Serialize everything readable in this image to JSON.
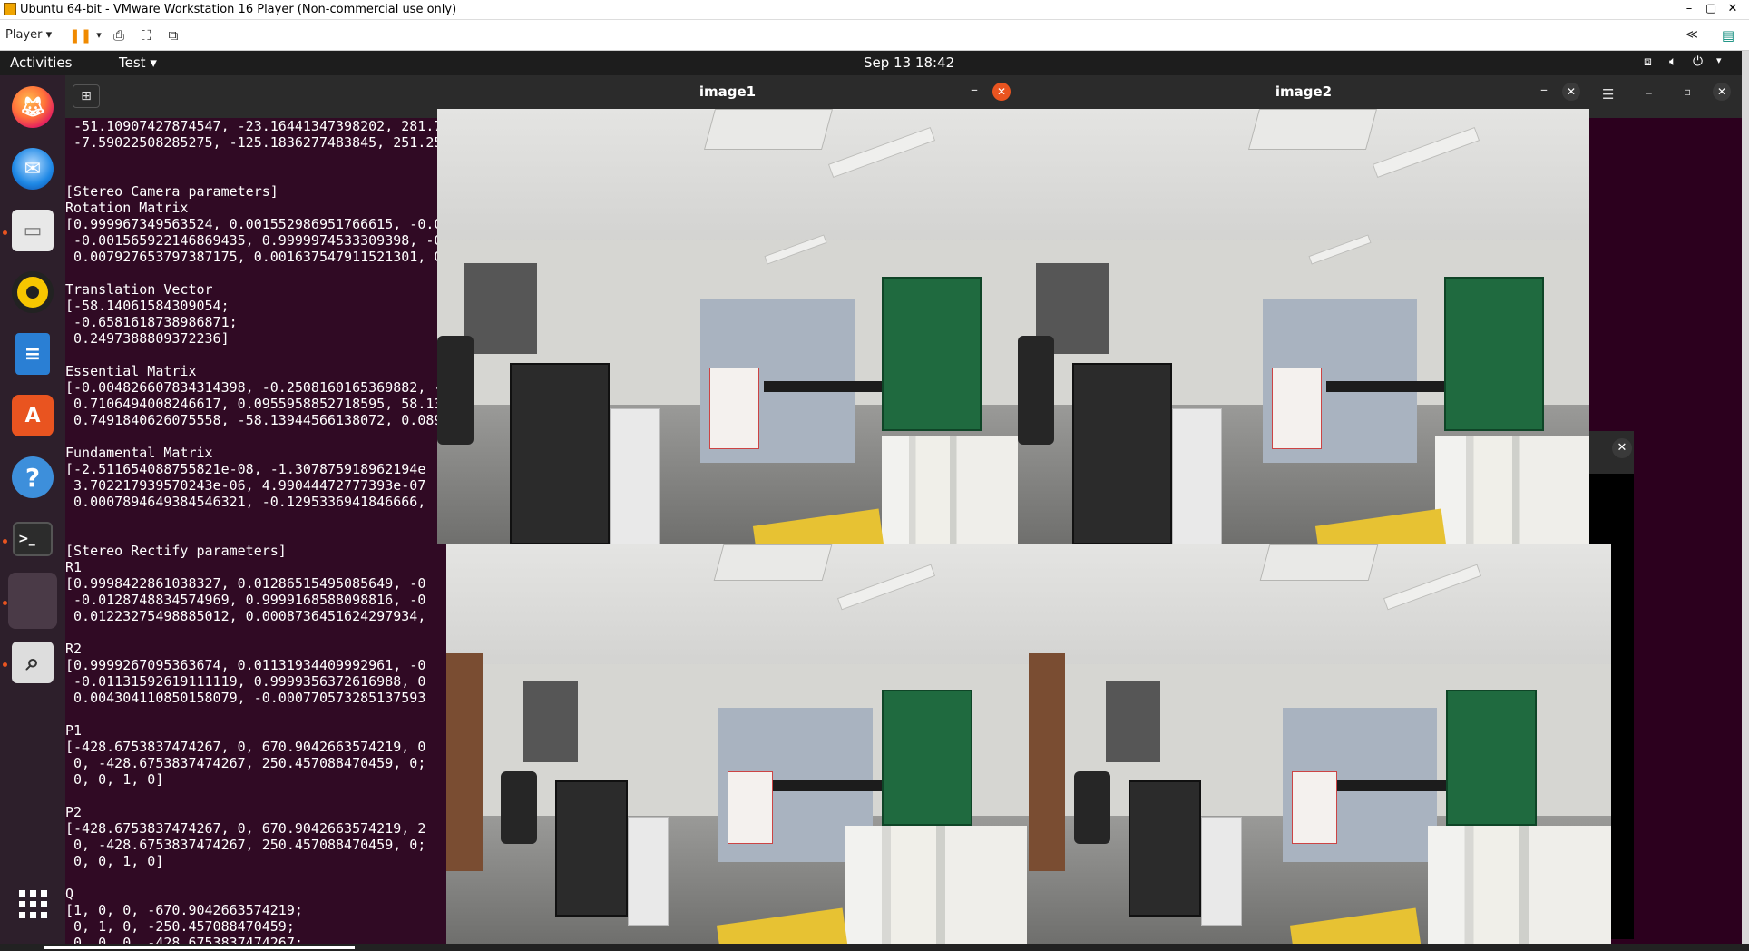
{
  "vm_window": {
    "title": "Ubuntu 64-bit - VMware Workstation 16 Player (Non-commercial use only)",
    "controls": [
      "–",
      "▢",
      "✕"
    ],
    "toolbar": {
      "player_label": "Player"
    }
  },
  "top_bar": {
    "activities": "Activities",
    "app_menu": "Test",
    "clock": "Sep 13  18:42"
  },
  "dock": {
    "items": [
      {
        "name": "firefox-icon",
        "running": false
      },
      {
        "name": "thunderbird-icon",
        "running": false
      },
      {
        "name": "files-icon",
        "running": true
      },
      {
        "name": "rhythmbox-icon",
        "running": false
      },
      {
        "name": "libreoffice-writer-icon",
        "running": false
      },
      {
        "name": "ubuntu-software-icon",
        "running": false
      },
      {
        "name": "help-icon",
        "running": false
      },
      {
        "name": "terminal-icon",
        "running": true
      },
      {
        "name": "test-app-icon",
        "running": true
      },
      {
        "name": "image-viewer-icon",
        "running": true
      }
    ],
    "show_apps_icon": "show-applications-icon"
  },
  "terminal": {
    "lines": [
      " -51.10907427874547, -23.16441347398202, 281.7",
      " -7.59022508285275, -125.1836277483845, 251.25",
      "",
      "",
      "[Stereo Camera parameters]",
      "Rotation Matrix",
      "[0.999967349563524, 0.001552986951766615, -0.0",
      " -0.001565922146869435, 0.9999974533309398, -0",
      " 0.007927653797387175, 0.001637547911521301, 0",
      "",
      "Translation Vector",
      "[-58.14061584309054;",
      " -0.6581618738986871;",
      " 0.2497388809372236]",
      "",
      "Essential Matrix",
      "[-0.004826607834314398, -0.2508160165369882, -",
      " 0.7106494008246617, 0.0955958852718595, 58.13",
      " 0.7491840626075558, -58.13944566138072, 0.089",
      "",
      "Fundamental Matrix",
      "[-2.511654088755821e-08, -1.307875918962194e",
      " 3.702217939570243e-06, 4.99044472777393e-07",
      " 0.0007894649384546321, -0.1295336941846666,",
      "",
      "",
      "[Stereo Rectify parameters]",
      "R1",
      "[0.9998422861038327, 0.01286515495085649, -0",
      " -0.0128748834574969, 0.9999168588098816, -0",
      " 0.01223275498885012, 0.0008736451624297934,",
      "",
      "R2",
      "[0.9999267095363674, 0.01131934409992961, -0",
      " -0.01131592619111119, 0.9999356372616988, 0",
      " 0.004304110850158079, -0.000770573285137593",
      "",
      "P1",
      "[-428.6753837474267, 0, 670.9042663574219, 0",
      " 0, -428.6753837474267, 250.457088470459, 0;",
      " 0, 0, 1, 0]",
      "",
      "P2",
      "[-428.6753837474267, 0, 670.9042663574219, 2",
      " 0, -428.6753837474267, 250.457088470459, 0;",
      " 0, 0, 1, 0]",
      "",
      "Q",
      "[1, 0, 0, -670.9042663574219;",
      " 0, 1, 0, -250.457088470459;",
      " 0, 0, 0, -428.6753837474267;"
    ]
  },
  "windows": {
    "image1": {
      "title": "image1"
    },
    "image2": {
      "title": "image2"
    }
  }
}
